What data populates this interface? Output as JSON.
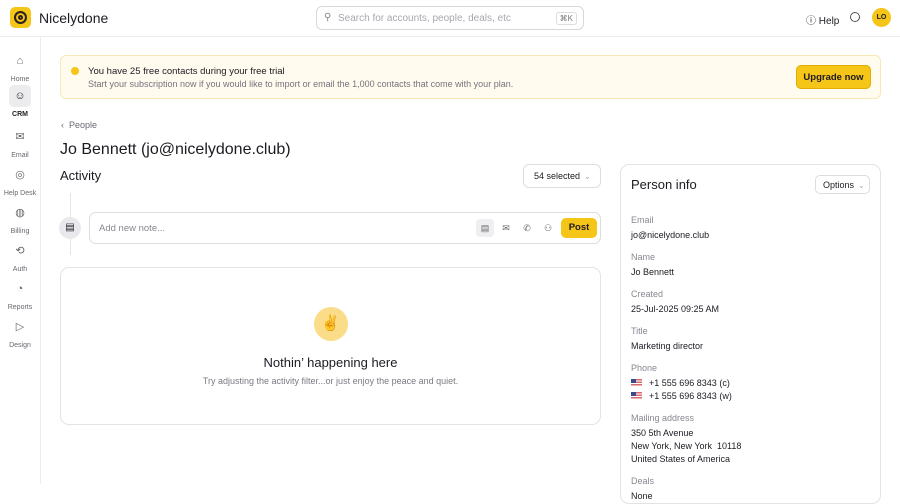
{
  "app": {
    "name": "Nicelydone",
    "search_placeholder": "Search for accounts, people, deals, etc",
    "search_shortcut": "⌘K",
    "help": "Help",
    "avatar": "LO"
  },
  "sidebar": {
    "items": [
      {
        "label": "Home",
        "icon": "⌂"
      },
      {
        "label": "CRM",
        "icon": "☺"
      },
      {
        "label": "Email",
        "icon": "✉"
      },
      {
        "label": "Help Desk",
        "icon": "◎"
      },
      {
        "label": "Billing",
        "icon": "◍"
      },
      {
        "label": "Auth",
        "icon": "⟲"
      },
      {
        "label": "Reports",
        "icon": "◔"
      },
      {
        "label": "Design",
        "icon": "▷"
      }
    ]
  },
  "banner": {
    "title": "You have 25 free contacts during your free trial",
    "text": "Start your subscription now if you would like to import or email the 1,000 contacts that come with your plan.",
    "button": "Upgrade now"
  },
  "breadcrumb": "People",
  "title": "Jo Bennett (jo@nicelydone.club)",
  "activity": {
    "heading": "Activity",
    "filter": "54 selected",
    "note_placeholder": "Add new note...",
    "post": "Post",
    "empty_title": "Nothin’ happening here",
    "empty_text": "Try adjusting the activity filter...or just enjoy the peace and quiet."
  },
  "person": {
    "heading": "Person info",
    "options": "Options",
    "email_label": "Email",
    "email": "jo@nicelydone.club",
    "name_label": "Name",
    "name": "Jo Bennett",
    "created_label": "Created",
    "created": "25-Jul-2025 09:25 AM",
    "title_label": "Title",
    "title": "Marketing director",
    "phone_label": "Phone",
    "phones": [
      "+1 555 696 8343 (c)",
      "+1 555 696 8343 (w)"
    ],
    "address_label": "Mailing address",
    "address": [
      "350 5th Avenue",
      "New York, New York  10118",
      "United States of America"
    ],
    "deals_label": "Deals",
    "deals": "None"
  }
}
